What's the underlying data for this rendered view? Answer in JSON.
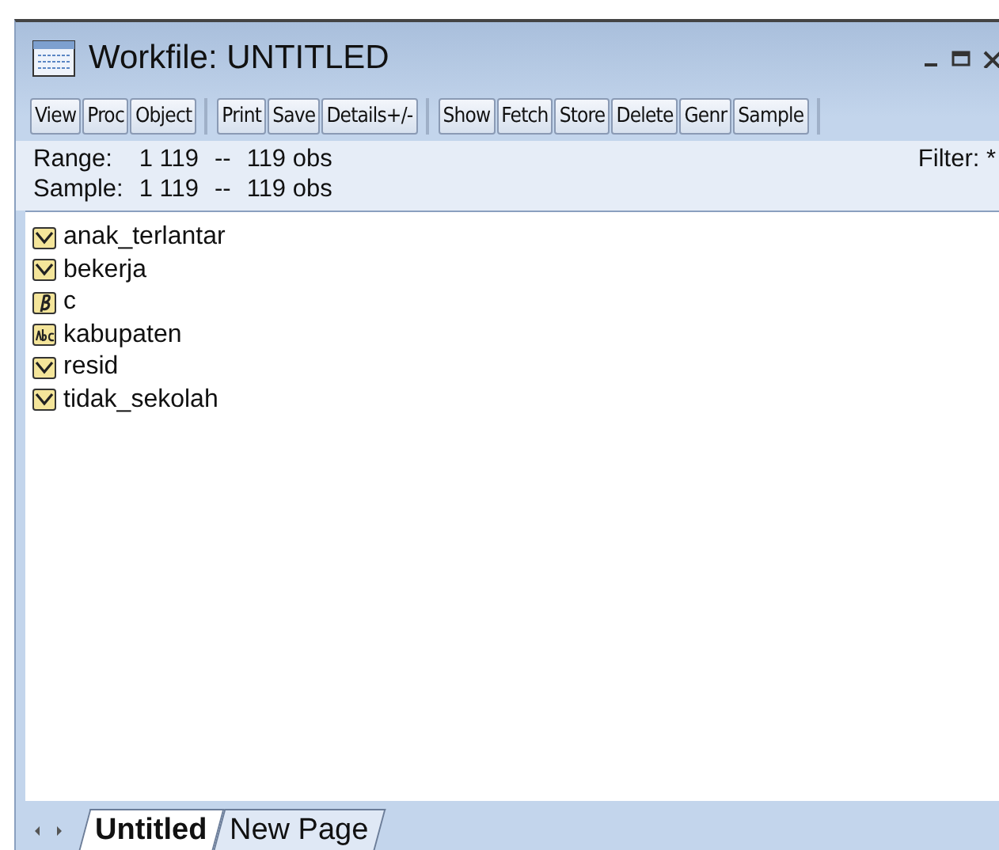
{
  "window": {
    "title": "Workfile: UNTITLED"
  },
  "toolbar": [
    [
      "View",
      "Proc",
      "Object"
    ],
    [
      "Print",
      "Save",
      "Details+/-"
    ],
    [
      "Show",
      "Fetch",
      "Store",
      "Delete",
      "Genr",
      "Sample"
    ]
  ],
  "info": {
    "range_label": "Range:",
    "range_value": "1 119",
    "range_sep": "--",
    "range_obs": "119 obs",
    "sample_label": "Sample:",
    "sample_value": "1 119",
    "sample_sep": "--",
    "sample_obs": "119 obs",
    "filter": "Filter: *"
  },
  "objects": [
    {
      "name": "anak_terlantar",
      "kind": "series"
    },
    {
      "name": "bekerja",
      "kind": "series"
    },
    {
      "name": "c",
      "kind": "coef"
    },
    {
      "name": "kabupaten",
      "kind": "alpha"
    },
    {
      "name": "resid",
      "kind": "series"
    },
    {
      "name": "tidak_sekolah",
      "kind": "series"
    }
  ],
  "pages": [
    {
      "label": "Untitled",
      "selected": true
    },
    {
      "label": "New Page",
      "selected": false
    }
  ]
}
